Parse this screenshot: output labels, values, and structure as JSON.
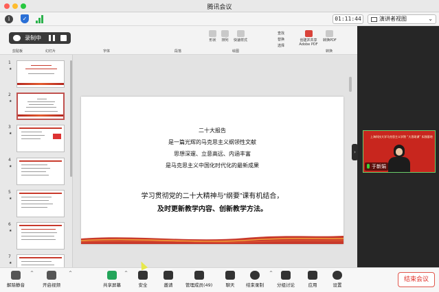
{
  "window": {
    "title": "腾讯会议"
  },
  "topbar": {
    "timer": "01:11:44",
    "view_label": "演讲者视图"
  },
  "recording": {
    "label": "录制中"
  },
  "ribbon": {
    "groups": [
      "剪贴板",
      "幻灯片",
      "字体",
      "段落",
      "绘图",
      "创建并共享 Adobe PDF",
      "转换"
    ],
    "items": [
      "形状",
      "排列",
      "快速样式",
      "查找",
      "替换",
      "选择",
      "创建并共享\nAdobe PDF",
      "转换PDF"
    ]
  },
  "thumbnails": [
    {
      "num": "1",
      "star": "★"
    },
    {
      "num": "2",
      "star": "★"
    },
    {
      "num": "3",
      "star": "★"
    },
    {
      "num": "4",
      "star": "★"
    },
    {
      "num": "5",
      "star": "★"
    },
    {
      "num": "6",
      "star": "★"
    },
    {
      "num": "7",
      "star": "★"
    }
  ],
  "slide": {
    "line1": "二十大报告",
    "line2": "是一篇光辉的马克思主义纲领性文献",
    "line3": "思想深邃、立意高远、内涵丰富",
    "line4": "是马克思主义中国化时代化的最新成果",
    "line5": "学习贯彻党的二十大精神与“纲要”课有机结合，",
    "line6": "及时更新教学内容、创新教学方法。"
  },
  "video": {
    "name": "于新娟",
    "banner": "上海科技大学马克思主义学院 “大思政课” 实践基地"
  },
  "toolbar": {
    "mute": "解除静音",
    "video": "开启视频",
    "share": "共享屏幕",
    "security": "安全",
    "invite": "邀请",
    "members": "管理成员(49)",
    "chat": "聊天",
    "record": "结束录制",
    "breakout": "分组讨论",
    "apps": "应用",
    "settings": "设置",
    "end": "结束会议"
  },
  "colors": {
    "accent_red": "#c8392b",
    "end_red": "#e0312a",
    "video_border": "#6bd06b"
  }
}
